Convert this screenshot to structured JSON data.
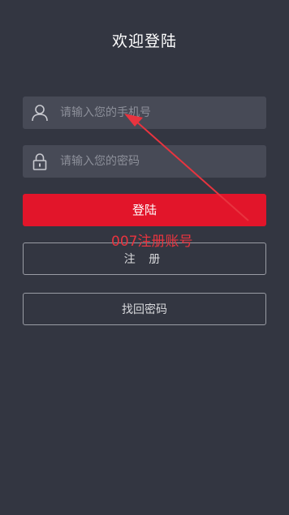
{
  "header": {
    "title": "欢迎登陆"
  },
  "form": {
    "phone_placeholder": "请输入您的手机号",
    "phone_value": "",
    "password_placeholder": "请输入您的密码",
    "password_value": ""
  },
  "buttons": {
    "login_label": "登陆",
    "register_label": "注 册",
    "forgot_label": "找回密码"
  },
  "annotation": {
    "text": "007注册账号"
  },
  "colors": {
    "background": "#333641",
    "field_background": "#474a56",
    "accent": "#e2152a",
    "annotation": "#e8343f"
  },
  "icons": {
    "phone_field": "user-icon",
    "password_field": "lock-icon"
  }
}
